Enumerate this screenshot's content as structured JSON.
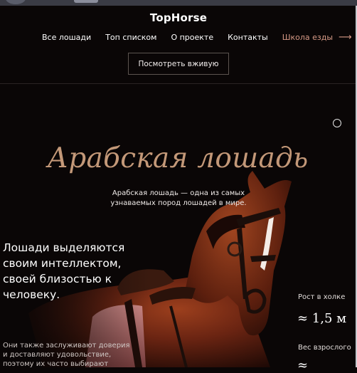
{
  "brand": "TopHorse",
  "nav": {
    "items": [
      "Все лошади",
      "Топ списком",
      "О проекте",
      "Контакты"
    ],
    "accent_item": "Школа езды",
    "accent_color": "#d79a86",
    "arrow_icon": "arrow-right-icon"
  },
  "cta": {
    "label": "Посмотреть вживую"
  },
  "hero": {
    "title": "Арабская лошадь",
    "title_color": "#c39878",
    "lead": "Арабская лошадь — одна из самых узнаваемых пород лошадей в мире.",
    "headline": "Лошади выделяются своим интеллектом, своей близостью к человеку.",
    "fade_text": "Они также заслуживают доверия и доставляют удовольствие, поэтому их часто выбирают"
  },
  "stats": [
    {
      "label": "Рост в холке",
      "value": "≈ 1,5 м"
    },
    {
      "label": "Вес взрослого",
      "value": "≈"
    }
  ]
}
